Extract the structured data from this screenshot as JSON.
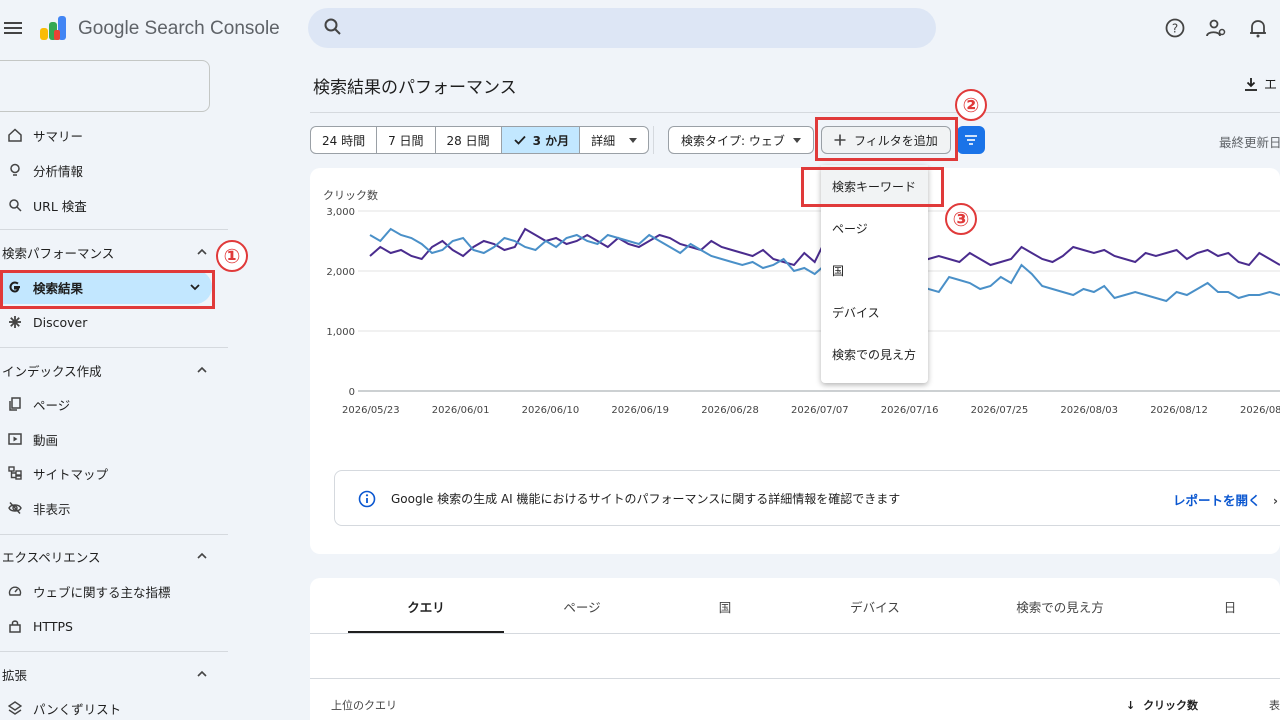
{
  "app": {
    "brand": "Google Search Console"
  },
  "search": {
    "placeholder": ""
  },
  "sidebar": {
    "top_items": [
      {
        "label": "サマリー",
        "icon": "home-icon"
      },
      {
        "label": "分析情報",
        "icon": "lightbulb-icon"
      },
      {
        "label": "URL 検査",
        "icon": "search-icon"
      }
    ],
    "section_performance": "検索パフォーマンス",
    "perf_items": [
      {
        "label": "検索結果",
        "icon": "google-g-icon"
      },
      {
        "label": "Discover",
        "icon": "asterisk-icon"
      }
    ],
    "section_index": "インデックス作成",
    "index_items": [
      {
        "label": "ページ",
        "icon": "pages-icon"
      },
      {
        "label": "動画",
        "icon": "video-icon"
      },
      {
        "label": "サイトマップ",
        "icon": "sitemap-icon"
      },
      {
        "label": "非表示",
        "icon": "eye-off-icon"
      }
    ],
    "section_experience": "エクスペリエンス",
    "exp_items": [
      {
        "label": "ウェブに関する主な指標",
        "icon": "gauge-icon"
      },
      {
        "label": "HTTPS",
        "icon": "lock-icon"
      }
    ],
    "section_enhancements": "拡張",
    "enh_items": [
      {
        "label": "パンくずリスト",
        "icon": "layers-icon"
      }
    ]
  },
  "main": {
    "title": "検索結果のパフォーマンス",
    "export_label": "エ",
    "date_ranges": [
      "24 時間",
      "7 日間",
      "28 日間",
      "3 か月",
      "詳細"
    ],
    "search_type": "検索タイプ: ウェブ",
    "add_filter": "フィルタを追加",
    "last_updated": "最終更新日",
    "filter_menu": [
      "検索キーワード",
      "ページ",
      "国",
      "デバイス",
      "検索での見え方"
    ],
    "info_text": "Google 検索の生成 AI 機能におけるサイトのパフォーマンスに関する詳細情報を確認できます",
    "info_link": "レポートを開く",
    "tabs": [
      "クエリ",
      "ページ",
      "国",
      "デバイス",
      "検索での見え方",
      "日"
    ],
    "table_headers": {
      "top_queries": "上位のクエリ",
      "clicks": "クリック数",
      "impressions": "表"
    }
  },
  "annotations": [
    "①",
    "②",
    "③"
  ],
  "colors": {
    "clicks_line": "#4a2c8e",
    "impr_line": "#4a90c8",
    "accent": "#1a73e8",
    "highlight": "#e03a3a"
  },
  "chart_data": {
    "type": "line",
    "ylabel": "クリック数",
    "yticks": [
      "3,000",
      "2,000",
      "1,000",
      "0"
    ],
    "ylim": [
      0,
      3000
    ],
    "xticks": [
      "2026/05/23",
      "2026/06/01",
      "2026/06/10",
      "2026/06/19",
      "2026/06/28",
      "2026/07/07",
      "2026/07/16",
      "2026/07/25",
      "2026/08/03",
      "2026/08/12",
      "2026/08"
    ],
    "series": [
      {
        "color": "#4a2c8e",
        "values": [
          2250,
          2400,
          2300,
          2350,
          2250,
          2200,
          2400,
          2500,
          2350,
          2250,
          2400,
          2500,
          2450,
          2350,
          2400,
          2700,
          2600,
          2500,
          2550,
          2450,
          2500,
          2600,
          2500,
          2400,
          2550,
          2450,
          2400,
          2500,
          2600,
          2550,
          2450,
          2400,
          2350,
          2500,
          2400,
          2350,
          2300,
          2250,
          2350,
          2200,
          2150,
          2100,
          2300,
          2150,
          2500,
          2400,
          2100,
          2050,
          2050,
          2100,
          2150,
          2100,
          2050,
          2150,
          2200,
          2250,
          2200,
          2150,
          2300,
          2200,
          2100,
          2150,
          2200,
          2400,
          2300,
          2200,
          2150,
          2250,
          2400,
          2350,
          2300,
          2350,
          2250,
          2200,
          2150,
          2300,
          2250,
          2300,
          2350,
          2200,
          2300,
          2350,
          2250,
          2300,
          2150,
          2100,
          2300,
          2200,
          2100
        ],
        "name": ""
      },
      {
        "color": "#4a90c8",
        "values": [
          2600,
          2500,
          2700,
          2600,
          2550,
          2450,
          2300,
          2350,
          2500,
          2550,
          2350,
          2300,
          2400,
          2550,
          2500,
          2400,
          2350,
          2500,
          2400,
          2550,
          2600,
          2500,
          2450,
          2600,
          2550,
          2500,
          2450,
          2600,
          2500,
          2400,
          2300,
          2450,
          2350,
          2250,
          2200,
          2150,
          2100,
          2150,
          2050,
          2100,
          2200,
          2000,
          2050,
          1950,
          2100,
          2000,
          2050,
          1900,
          1950,
          1850,
          1800,
          1950,
          1850,
          1800,
          1700,
          1650,
          1900,
          1850,
          1800,
          1700,
          1750,
          1900,
          1800,
          2100,
          1950,
          1750,
          1700,
          1650,
          1600,
          1700,
          1650,
          1750,
          1550,
          1600,
          1650,
          1600,
          1550,
          1500,
          1650,
          1600,
          1700,
          1800,
          1650,
          1650,
          1550,
          1600,
          1600,
          1650,
          1600
        ],
        "name": ""
      }
    ]
  }
}
